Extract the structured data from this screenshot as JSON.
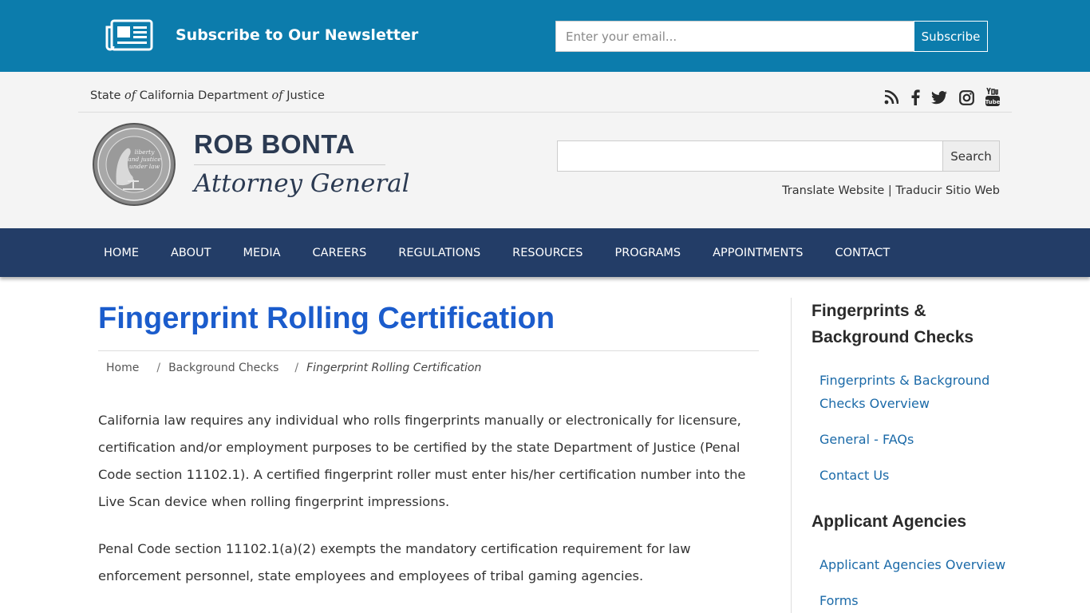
{
  "newsletter": {
    "title": "Subscribe to Our Newsletter",
    "email_placeholder": "Enter your email...",
    "subscribe_label": "Subscribe",
    "icon": "newspaper-icon"
  },
  "header": {
    "state_prefix": "State ",
    "state_of1": "of",
    "state_mid": " California Department ",
    "state_of2": "of",
    "state_suffix": " Justice",
    "social_icons": [
      "rss-icon",
      "facebook-icon",
      "twitter-icon",
      "instagram-icon",
      "youtube-icon"
    ],
    "seal_text": "liberty and justice under law",
    "brand_name": "ROB BONTA",
    "brand_subtitle": "Attorney General",
    "search_label": "Search",
    "translate_en": "Translate Website",
    "translate_sep": " | ",
    "translate_es": "Traducir Sitio Web"
  },
  "nav": {
    "items": [
      "HOME",
      "ABOUT",
      "MEDIA",
      "CAREERS",
      "REGULATIONS",
      "RESOURCES",
      "PROGRAMS",
      "APPOINTMENTS",
      "CONTACT"
    ]
  },
  "main": {
    "title": "Fingerprint Rolling Certification",
    "breadcrumb": {
      "home": "Home",
      "sep": "/",
      "parent": "Background Checks",
      "current": "Fingerprint Rolling Certification"
    },
    "paragraphs": [
      "California law requires any individual who rolls fingerprints manually or electronically for licensure, certification and/or employment purposes to be certified by the state Department of Justice (Penal Code section 11102.1). A certified fingerprint roller must enter his/her certification number into the Live Scan device when rolling fingerprint impressions.",
      "Penal Code section 11102.1(a)(2) exempts the mandatory certification requirement for law enforcement personnel, state employees and employees of tribal gaming agencies."
    ]
  },
  "sidebar": {
    "section1_title": "Fingerprints & Background Checks",
    "section1_links": [
      "Fingerprints & Background Checks Overview",
      "General - FAQs",
      "Contact Us"
    ],
    "section2_title": "Applicant Agencies",
    "section2_links": [
      "Applicant Agencies Overview",
      "Forms"
    ]
  }
}
